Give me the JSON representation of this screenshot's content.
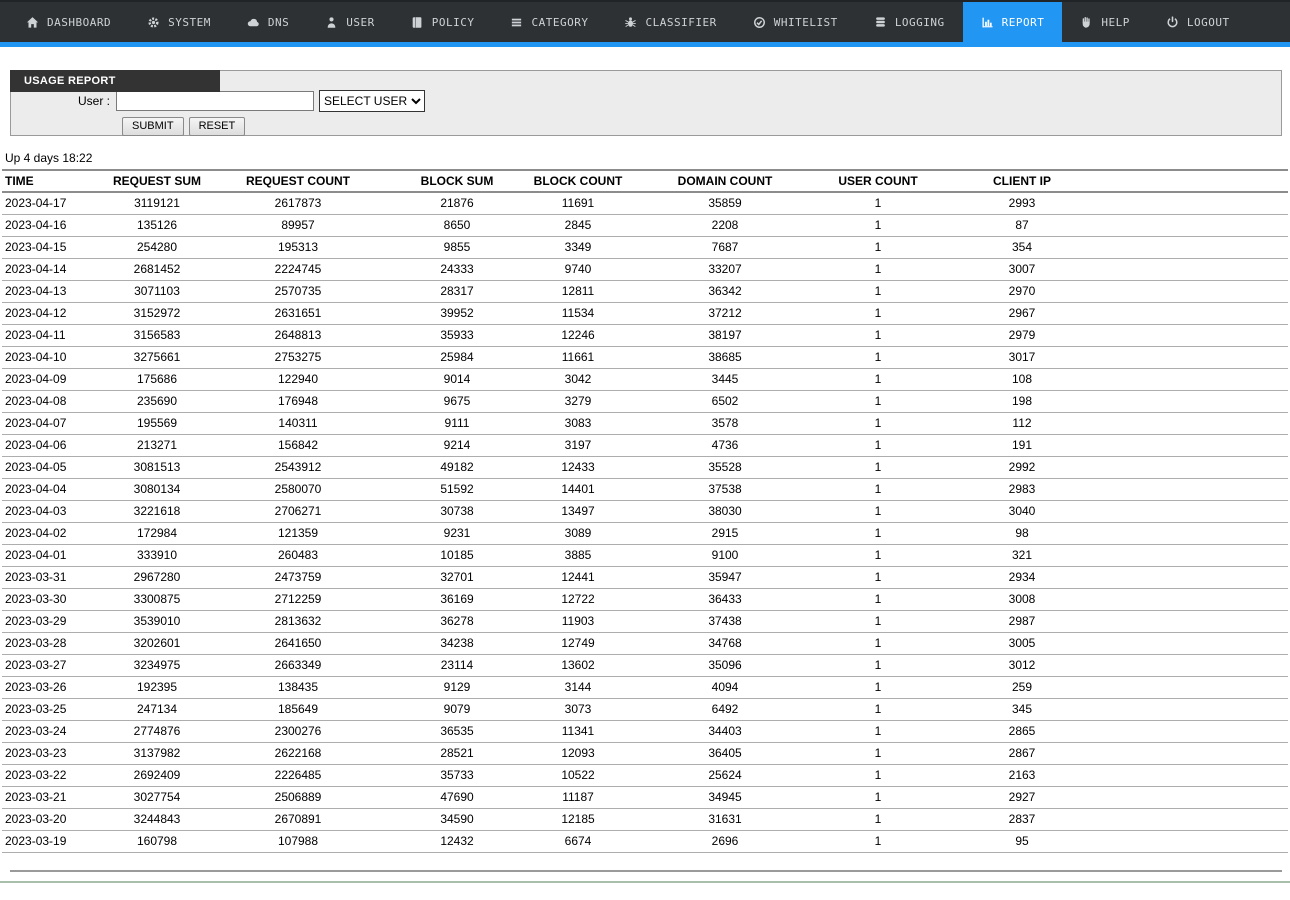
{
  "colors": {
    "accent": "#2196f3",
    "nav_bg": "#2d3134",
    "nav_text": "#cfd2d4",
    "tab_bg": "#333333",
    "panel_bg": "#ececec",
    "panel_border": "#9a9a9a",
    "strong_line": "#8c8c8c",
    "row_line": "#adadad",
    "footer_line": "#a9bfa9"
  },
  "nav": {
    "items": [
      {
        "label": "DASHBOARD",
        "icon": "home-icon",
        "active": false
      },
      {
        "label": "SYSTEM",
        "icon": "gear-icon",
        "active": false
      },
      {
        "label": "DNS",
        "icon": "cloud-icon",
        "active": false
      },
      {
        "label": "USER",
        "icon": "user-icon",
        "active": false
      },
      {
        "label": "POLICY",
        "icon": "book-icon",
        "active": false
      },
      {
        "label": "CATEGORY",
        "icon": "list-icon",
        "active": false
      },
      {
        "label": "CLASSIFIER",
        "icon": "bug-icon",
        "active": false
      },
      {
        "label": "WHITELIST",
        "icon": "circle-check-icon",
        "active": false
      },
      {
        "label": "LOGGING",
        "icon": "database-icon",
        "active": false
      },
      {
        "label": "REPORT",
        "icon": "bar-chart-icon",
        "active": true
      },
      {
        "label": "HELP",
        "icon": "hand-icon",
        "active": false
      },
      {
        "label": "LOGOUT",
        "icon": "power-icon",
        "active": false
      }
    ]
  },
  "report_form": {
    "title": "USAGE REPORT",
    "user_label": "User :",
    "user_input_value": "",
    "select_user_label": "SELECT USER",
    "submit_label": "SUBMIT",
    "reset_label": "RESET"
  },
  "uptime_text": "Up 4 days 18:22",
  "table": {
    "columns": [
      "TIME",
      "REQUEST SUM",
      "REQUEST COUNT",
      "BLOCK SUM",
      "BLOCK COUNT",
      "DOMAIN COUNT",
      "USER COUNT",
      "CLIENT IP"
    ],
    "rows": [
      [
        "2023-04-17",
        "3119121",
        "2617873",
        "21876",
        "11691",
        "35859",
        "1",
        "2993"
      ],
      [
        "2023-04-16",
        "135126",
        "89957",
        "8650",
        "2845",
        "2208",
        "1",
        "87"
      ],
      [
        "2023-04-15",
        "254280",
        "195313",
        "9855",
        "3349",
        "7687",
        "1",
        "354"
      ],
      [
        "2023-04-14",
        "2681452",
        "2224745",
        "24333",
        "9740",
        "33207",
        "1",
        "3007"
      ],
      [
        "2023-04-13",
        "3071103",
        "2570735",
        "28317",
        "12811",
        "36342",
        "1",
        "2970"
      ],
      [
        "2023-04-12",
        "3152972",
        "2631651",
        "39952",
        "11534",
        "37212",
        "1",
        "2967"
      ],
      [
        "2023-04-11",
        "3156583",
        "2648813",
        "35933",
        "12246",
        "38197",
        "1",
        "2979"
      ],
      [
        "2023-04-10",
        "3275661",
        "2753275",
        "25984",
        "11661",
        "38685",
        "1",
        "3017"
      ],
      [
        "2023-04-09",
        "175686",
        "122940",
        "9014",
        "3042",
        "3445",
        "1",
        "108"
      ],
      [
        "2023-04-08",
        "235690",
        "176948",
        "9675",
        "3279",
        "6502",
        "1",
        "198"
      ],
      [
        "2023-04-07",
        "195569",
        "140311",
        "9111",
        "3083",
        "3578",
        "1",
        "112"
      ],
      [
        "2023-04-06",
        "213271",
        "156842",
        "9214",
        "3197",
        "4736",
        "1",
        "191"
      ],
      [
        "2023-04-05",
        "3081513",
        "2543912",
        "49182",
        "12433",
        "35528",
        "1",
        "2992"
      ],
      [
        "2023-04-04",
        "3080134",
        "2580070",
        "51592",
        "14401",
        "37538",
        "1",
        "2983"
      ],
      [
        "2023-04-03",
        "3221618",
        "2706271",
        "30738",
        "13497",
        "38030",
        "1",
        "3040"
      ],
      [
        "2023-04-02",
        "172984",
        "121359",
        "9231",
        "3089",
        "2915",
        "1",
        "98"
      ],
      [
        "2023-04-01",
        "333910",
        "260483",
        "10185",
        "3885",
        "9100",
        "1",
        "321"
      ],
      [
        "2023-03-31",
        "2967280",
        "2473759",
        "32701",
        "12441",
        "35947",
        "1",
        "2934"
      ],
      [
        "2023-03-30",
        "3300875",
        "2712259",
        "36169",
        "12722",
        "36433",
        "1",
        "3008"
      ],
      [
        "2023-03-29",
        "3539010",
        "2813632",
        "36278",
        "11903",
        "37438",
        "1",
        "2987"
      ],
      [
        "2023-03-28",
        "3202601",
        "2641650",
        "34238",
        "12749",
        "34768",
        "1",
        "3005"
      ],
      [
        "2023-03-27",
        "3234975",
        "2663349",
        "23114",
        "13602",
        "35096",
        "1",
        "3012"
      ],
      [
        "2023-03-26",
        "192395",
        "138435",
        "9129",
        "3144",
        "4094",
        "1",
        "259"
      ],
      [
        "2023-03-25",
        "247134",
        "185649",
        "9079",
        "3073",
        "6492",
        "1",
        "345"
      ],
      [
        "2023-03-24",
        "2774876",
        "2300276",
        "36535",
        "11341",
        "34403",
        "1",
        "2865"
      ],
      [
        "2023-03-23",
        "3137982",
        "2622168",
        "28521",
        "12093",
        "36405",
        "1",
        "2867"
      ],
      [
        "2023-03-22",
        "2692409",
        "2226485",
        "35733",
        "10522",
        "25624",
        "1",
        "2163"
      ],
      [
        "2023-03-21",
        "3027754",
        "2506889",
        "47690",
        "11187",
        "34945",
        "1",
        "2927"
      ],
      [
        "2023-03-20",
        "3244843",
        "2670891",
        "34590",
        "12185",
        "31631",
        "1",
        "2837"
      ],
      [
        "2023-03-19",
        "160798",
        "107988",
        "12432",
        "6674",
        "2696",
        "1",
        "95"
      ]
    ]
  }
}
